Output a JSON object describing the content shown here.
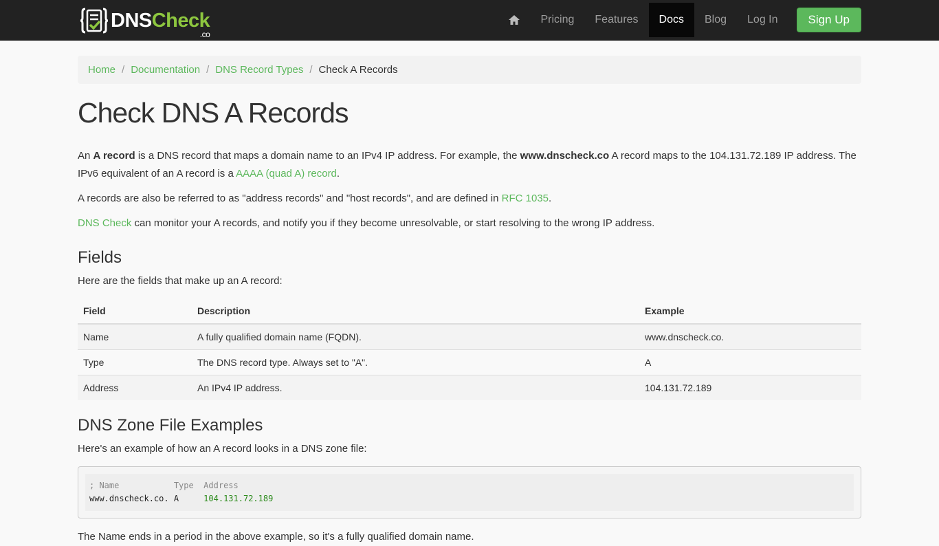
{
  "nav": {
    "logo": {
      "dns": "DNS",
      "check": "Check",
      "co": ".co"
    },
    "items": [
      "Pricing",
      "Features",
      "Docs",
      "Blog",
      "Log In"
    ],
    "active": "Docs",
    "signup": "Sign Up",
    "home_icon": "home-icon"
  },
  "breadcrumb": {
    "items": [
      "Home",
      "Documentation",
      "DNS Record Types"
    ],
    "current": "Check A Records",
    "separator": "/"
  },
  "title": "Check DNS A Records",
  "intro": {
    "p1_a": "An ",
    "p1_bold1": "A record",
    "p1_b": " is a DNS record that maps a domain name to an IPv4 IP address. For example, the ",
    "p1_bold2": "www.dnscheck.co",
    "p1_c": " A record maps to the 104.131.72.189 IP address. The IPv6 equivalent of an A record is a ",
    "p1_link": "AAAA (quad A) record",
    "p1_d": ".",
    "p2_a": "A records are also be referred to as \"address records\" and \"host records\", and are defined in ",
    "p2_link": "RFC 1035",
    "p2_b": ".",
    "p3_link": "DNS Check",
    "p3_a": " can monitor your A records, and notify you if they become unresolvable, or start resolving to the wrong IP address."
  },
  "fields": {
    "heading": "Fields",
    "lead": "Here are the fields that make up an A record:",
    "headers": [
      "Field",
      "Description",
      "Example"
    ],
    "rows": [
      [
        "Name",
        "A fully qualified domain name (FQDN).",
        "www.dnscheck.co."
      ],
      [
        "Type",
        "The DNS record type. Always set to \"A\".",
        "A"
      ],
      [
        "Address",
        "An IPv4 IP address.",
        "104.131.72.189"
      ]
    ]
  },
  "zone": {
    "heading": "DNS Zone File Examples",
    "lead": "Here's an example of how an A record looks in a DNS zone file:",
    "comment": "; Name           Type  Address",
    "line_prefix": "www.dnscheck.co. A     ",
    "line_ip": "104.131.72.189",
    "after": "The Name ends in a period in the above example, so it's a fully qualified domain name."
  },
  "colors": {
    "accent": "#5cb85c",
    "logo_green": "#8dc63f",
    "navbar": "#222222"
  }
}
